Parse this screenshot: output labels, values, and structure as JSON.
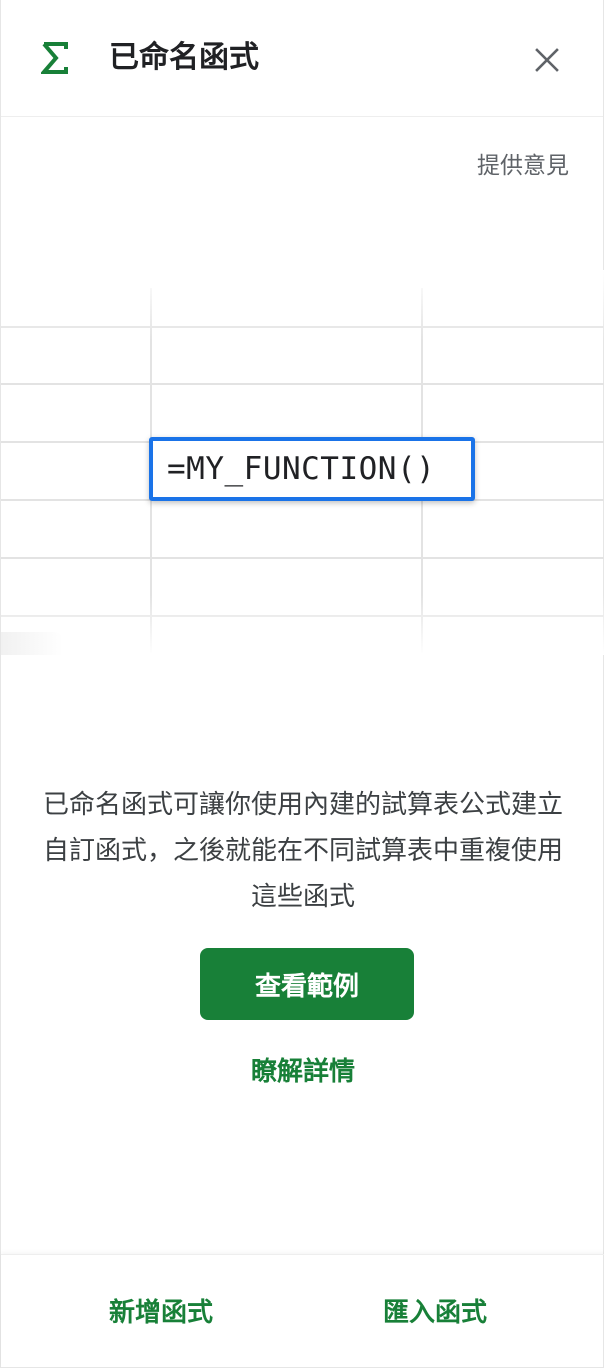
{
  "panel": {
    "title": "已命名函式",
    "icon": "sigma-icon",
    "close_icon": "close-icon"
  },
  "feedback_label": "提供意見",
  "illustration": {
    "formula": "=MY_FUNCTION()"
  },
  "description": "已命名函式可讓你使用內建的試算表公式建立自訂函式，之後就能在不同試算表中重複使用這些函式",
  "actions": {
    "view_examples_label": "查看範例",
    "learn_more_label": "瞭解詳情"
  },
  "footer": {
    "add_function_label": "新增函式",
    "import_function_label": "匯入函式"
  },
  "colors": {
    "brand_green": "#188038",
    "focus_blue": "#1a73e8",
    "text_primary": "#202124",
    "text_secondary": "#5f6368"
  }
}
